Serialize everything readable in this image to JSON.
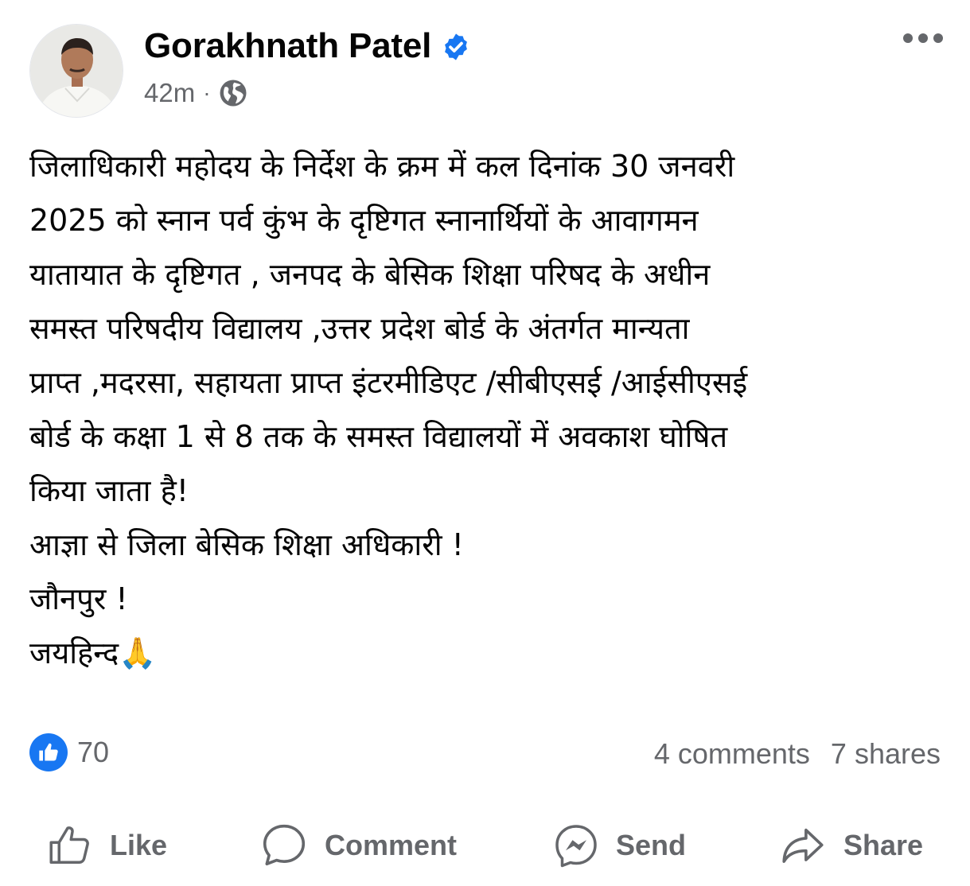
{
  "post": {
    "author": "Gorakhnath Patel",
    "time": "42m",
    "separator": "·",
    "body_lines": [
      "जिलाधिकारी महोदय के निर्देश के क्रम में कल दिनांक 30 जनवरी",
      "2025 को स्नान पर्व कुंभ के दृष्टिगत स्नानार्थियों के आवागमन",
      "यातायात के दृष्टिगत , जनपद के बेसिक शिक्षा परिषद के अधीन",
      "समस्त परिषदीय विद्यालय ,उत्तर प्रदेश बोर्ड के अंतर्गत मान्यता",
      "प्राप्त ,मदरसा, सहायता प्राप्त इंटरमीडिएट /सीबीएसई /आईसीएसई",
      "बोर्ड के कक्षा 1 से 8 तक के समस्त विद्यालयों में अवकाश घोषित",
      "किया जाता है!",
      "आज्ञा से जिला बेसिक शिक्षा अधिकारी !",
      "जौनपुर !",
      "जयहिन्द"
    ],
    "closing_emoji": "🙏",
    "likes": "70",
    "comments": "4 comments",
    "shares": "7 shares"
  },
  "actions": {
    "like": "Like",
    "comment": "Comment",
    "send": "Send",
    "share": "Share"
  },
  "colors": {
    "brand": "#1877f2",
    "secondary_text": "#65676b",
    "primary_text": "#050505"
  },
  "icons": [
    "verified-badge-icon",
    "globe-icon",
    "more-options-icon",
    "like-reaction-icon",
    "thumbs-up-icon",
    "comment-bubble-icon",
    "messenger-icon",
    "share-arrow-icon"
  ]
}
